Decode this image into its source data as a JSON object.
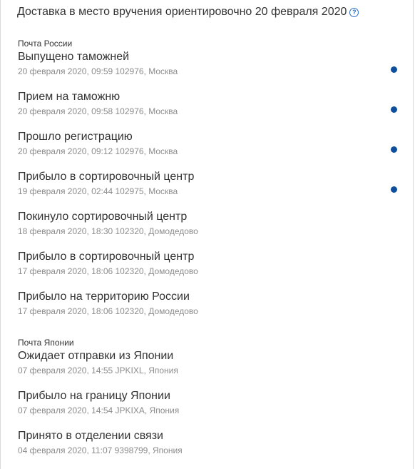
{
  "header": {
    "text": "Доставка в место вручения ориентировочно 20 февраля 2020",
    "help_icon": "?"
  },
  "sections": [
    {
      "title": "Почта России",
      "events": [
        {
          "status": "Выпущено таможней",
          "details": "20 февраля 2020, 09:59 102976, Москва",
          "dot": true
        },
        {
          "status": "Прием на таможню",
          "details": "20 февраля 2020, 09:58 102976, Москва",
          "dot": true
        },
        {
          "status": "Прошло регистрацию",
          "details": "20 февраля 2020, 09:12 102976, Москва",
          "dot": true
        },
        {
          "status": "Прибыло в сортировочный центр",
          "details": "19 февраля 2020, 02:44 102975, Москва",
          "dot": true
        },
        {
          "status": "Покинуло сортировочный центр",
          "details": "18 февраля 2020, 18:30 102320, Домодедово",
          "dot": false
        },
        {
          "status": "Прибыло в сортировочный центр",
          "details": "17 февраля 2020, 18:06 102320, Домодедово",
          "dot": false
        },
        {
          "status": "Прибыло на территорию России",
          "details": "17 февраля 2020, 18:06 102320, Домодедово",
          "dot": false
        }
      ]
    },
    {
      "title": "Почта Японии",
      "events": [
        {
          "status": "Ожидает отправки из Японии",
          "details": "07 февраля 2020, 14:55 JPKIXL, Япония",
          "dot": false
        },
        {
          "status": "Прибыло на границу Японии",
          "details": "07 февраля 2020, 14:54 JPKIXA, Япония",
          "dot": false
        },
        {
          "status": "Принято в отделении связи",
          "details": "04 февраля 2020, 11:07 9398799, Япония",
          "dot": false
        }
      ]
    }
  ],
  "colors": {
    "dot": "#0d4f9c",
    "help_icon": "#2a6ecb",
    "meta_text": "#8c8c8c"
  }
}
